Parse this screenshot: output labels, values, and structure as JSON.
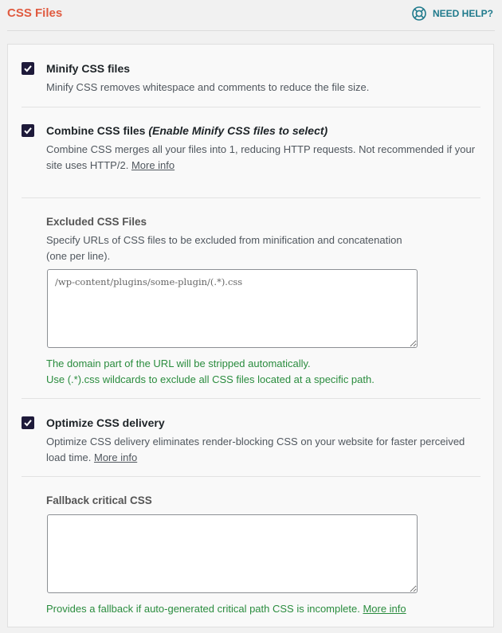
{
  "header": {
    "title": "CSS Files",
    "help_label": "NEED HELP?"
  },
  "options": {
    "minify": {
      "checked": true,
      "title": "Minify CSS files",
      "description": "Minify CSS removes whitespace and comments to reduce the file size."
    },
    "combine": {
      "checked": true,
      "title": "Combine CSS files",
      "title_note": "(Enable Minify CSS files to select)",
      "description_line1": "Combine CSS merges all your files into 1, reducing HTTP requests. Not recommended if your",
      "description_line2": "site uses HTTP/2.",
      "more_info": "More info"
    },
    "excluded": {
      "title": "Excluded CSS Files",
      "description_line1": "Specify URLs of CSS files to be excluded from minification and concatenation",
      "description_line2": "(one per line).",
      "placeholder": "/wp-content/plugins/some-plugin/(.*).css",
      "value": "",
      "note_line1": "The domain part of the URL will be stripped automatically.",
      "note_line2": "Use (.*).css wildcards to exclude all CSS files located at a specific path."
    },
    "optimize_delivery": {
      "checked": true,
      "title": "Optimize CSS delivery",
      "description_line1": "Optimize CSS delivery eliminates render-blocking CSS on your website for faster perceived",
      "description_line2": "load time.",
      "more_info": "More info"
    },
    "fallback": {
      "title": "Fallback critical CSS",
      "value": "",
      "note": "Provides a fallback if auto-generated critical path CSS is incomplete.",
      "more_info": "More info"
    }
  },
  "colors": {
    "title": "#e05a3f",
    "help": "#1f7a8c",
    "checkbox": "#1e1a3a",
    "note": "#2a8c3e"
  }
}
